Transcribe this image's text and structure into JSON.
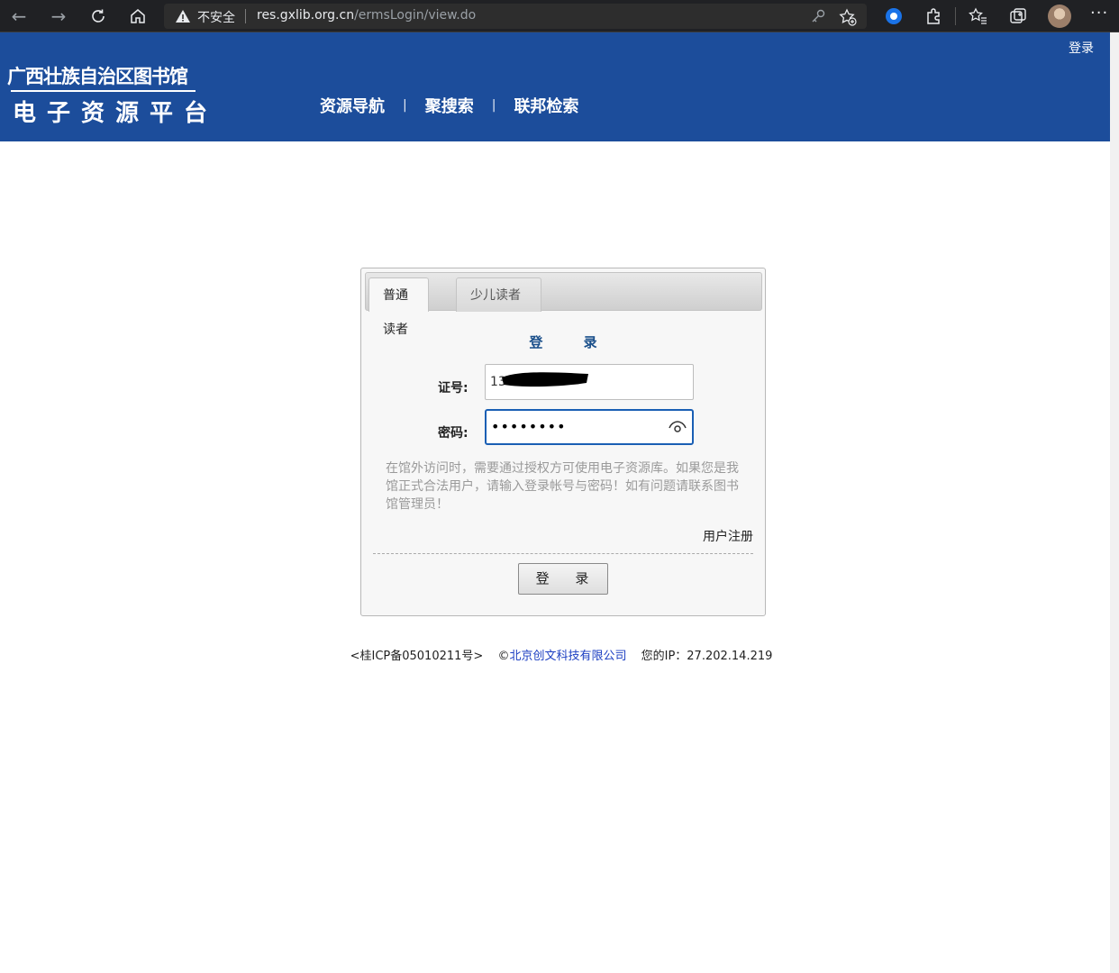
{
  "browser": {
    "security_label": "不安全",
    "url_host": "res.gxlib.org.cn",
    "url_path": "/ermsLogin/view.do"
  },
  "header": {
    "login_link": "登录",
    "logo_line1": "广西壮族自治区图书馆",
    "logo_line2": "电子资源平台",
    "nav": [
      "资源导航",
      "聚搜索",
      "联邦检索"
    ],
    "bg_color": "#1c4d9b"
  },
  "login": {
    "tabs": [
      "普通读者",
      "少儿读者"
    ],
    "title": "登 录",
    "id_label": "证号:",
    "id_value": "13",
    "pw_label": "密码:",
    "pw_value": "••••••••",
    "notice": "在馆外访问时，需要通过授权方可使用电子资源库。如果您是我馆正式合法用户，请输入登录帐号与密码！如有问题请联系图书馆管理员！",
    "register_link": "用户注册",
    "submit_label": "登 录"
  },
  "footer": {
    "icp": "<桂ICP备05010211号>",
    "copyright_symbol": "©",
    "company": "北京创文科技有限公司",
    "ip_text": "您的IP：27.202.14.219"
  }
}
